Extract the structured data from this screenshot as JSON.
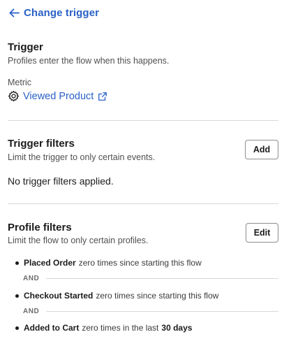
{
  "header": {
    "back_label": "Change trigger"
  },
  "trigger": {
    "title": "Trigger",
    "description": "Profiles enter the flow when this happens.",
    "metric_label": "Metric",
    "metric_value": "Viewed Product"
  },
  "trigger_filters": {
    "title": "Trigger filters",
    "description": "Limit the trigger to only certain events.",
    "add_label": "Add",
    "empty_text": "No trigger filters applied."
  },
  "profile_filters": {
    "title": "Profile filters",
    "description": "Limit the flow to only certain profiles.",
    "edit_label": "Edit",
    "and_label": "AND",
    "items": [
      {
        "name": "Placed Order",
        "condition": "zero times since starting this flow",
        "extra": ""
      },
      {
        "name": "Checkout Started",
        "condition": "zero times since starting this flow",
        "extra": ""
      },
      {
        "name": "Added to Cart",
        "condition": "zero times in the last",
        "extra": "30 days"
      }
    ]
  },
  "colors": {
    "link": "#2a61c6",
    "divider": "#d8d8d8",
    "button_border": "#8d8d8d"
  },
  "icons": {
    "back": "arrow-left-icon",
    "metric": "gear-icon",
    "external": "external-link-icon"
  }
}
